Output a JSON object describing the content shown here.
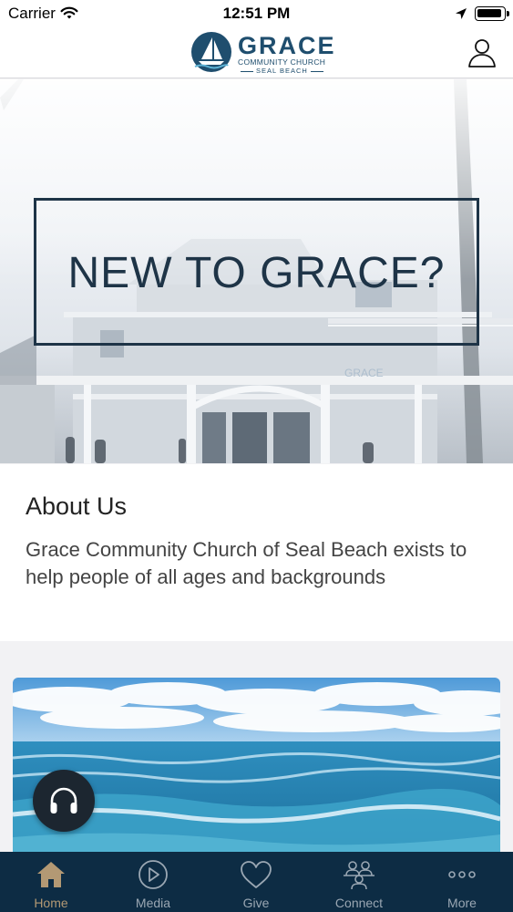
{
  "status_bar": {
    "carrier": "Carrier",
    "time": "12:51 PM"
  },
  "header": {
    "logo": {
      "name": "GRACE",
      "line1": "COMMUNITY CHURCH",
      "line2": "SEAL BEACH"
    },
    "profile_icon": "person-icon"
  },
  "hero": {
    "title": "NEW TO GRACE?"
  },
  "about": {
    "title": "About Us",
    "description": "Grace Community Church of Seal Beach exists to help people of all ages and backgrounds"
  },
  "audio_player": {
    "icon": "headphones-icon"
  },
  "tab_bar": {
    "tabs": [
      {
        "label": "Home",
        "icon": "home-icon",
        "active": true
      },
      {
        "label": "Media",
        "icon": "play-circle-icon",
        "active": false
      },
      {
        "label": "Give",
        "icon": "heart-icon",
        "active": false
      },
      {
        "label": "Connect",
        "icon": "people-icon",
        "active": false
      },
      {
        "label": "More",
        "icon": "more-icon",
        "active": false
      }
    ]
  },
  "colors": {
    "brand_navy": "#1f4e6e",
    "tab_bar_bg": "#0d2c44",
    "tab_active": "#b39974",
    "tab_inactive": "#9aa7b3"
  }
}
